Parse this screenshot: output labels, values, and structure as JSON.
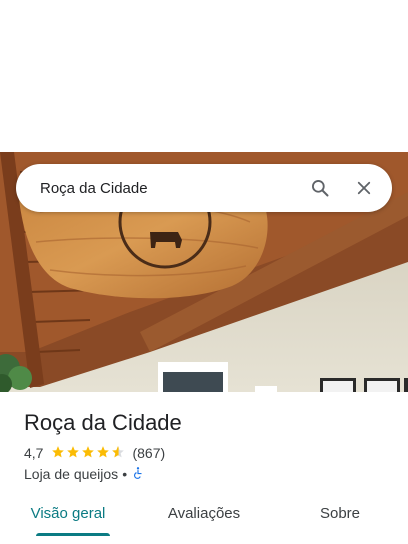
{
  "search": {
    "value": "Roça da Cidade"
  },
  "place": {
    "name": "Roça da Cidade",
    "rating": "4,7",
    "rating_value": 4.7,
    "review_count": "(867)",
    "category": "Loja de queijos",
    "separator": "•"
  },
  "tabs": [
    {
      "label": "Visão geral",
      "active": true
    },
    {
      "label": "Avaliações",
      "active": false
    },
    {
      "label": "Sobre",
      "active": false
    }
  ],
  "colors": {
    "accent": "#0b7b83",
    "star": "#fbbc04",
    "accessibility": "#1a73e8"
  },
  "icons": {
    "search": "search-icon",
    "close": "close-icon",
    "accessibility": "wheelchair-accessible-icon"
  }
}
